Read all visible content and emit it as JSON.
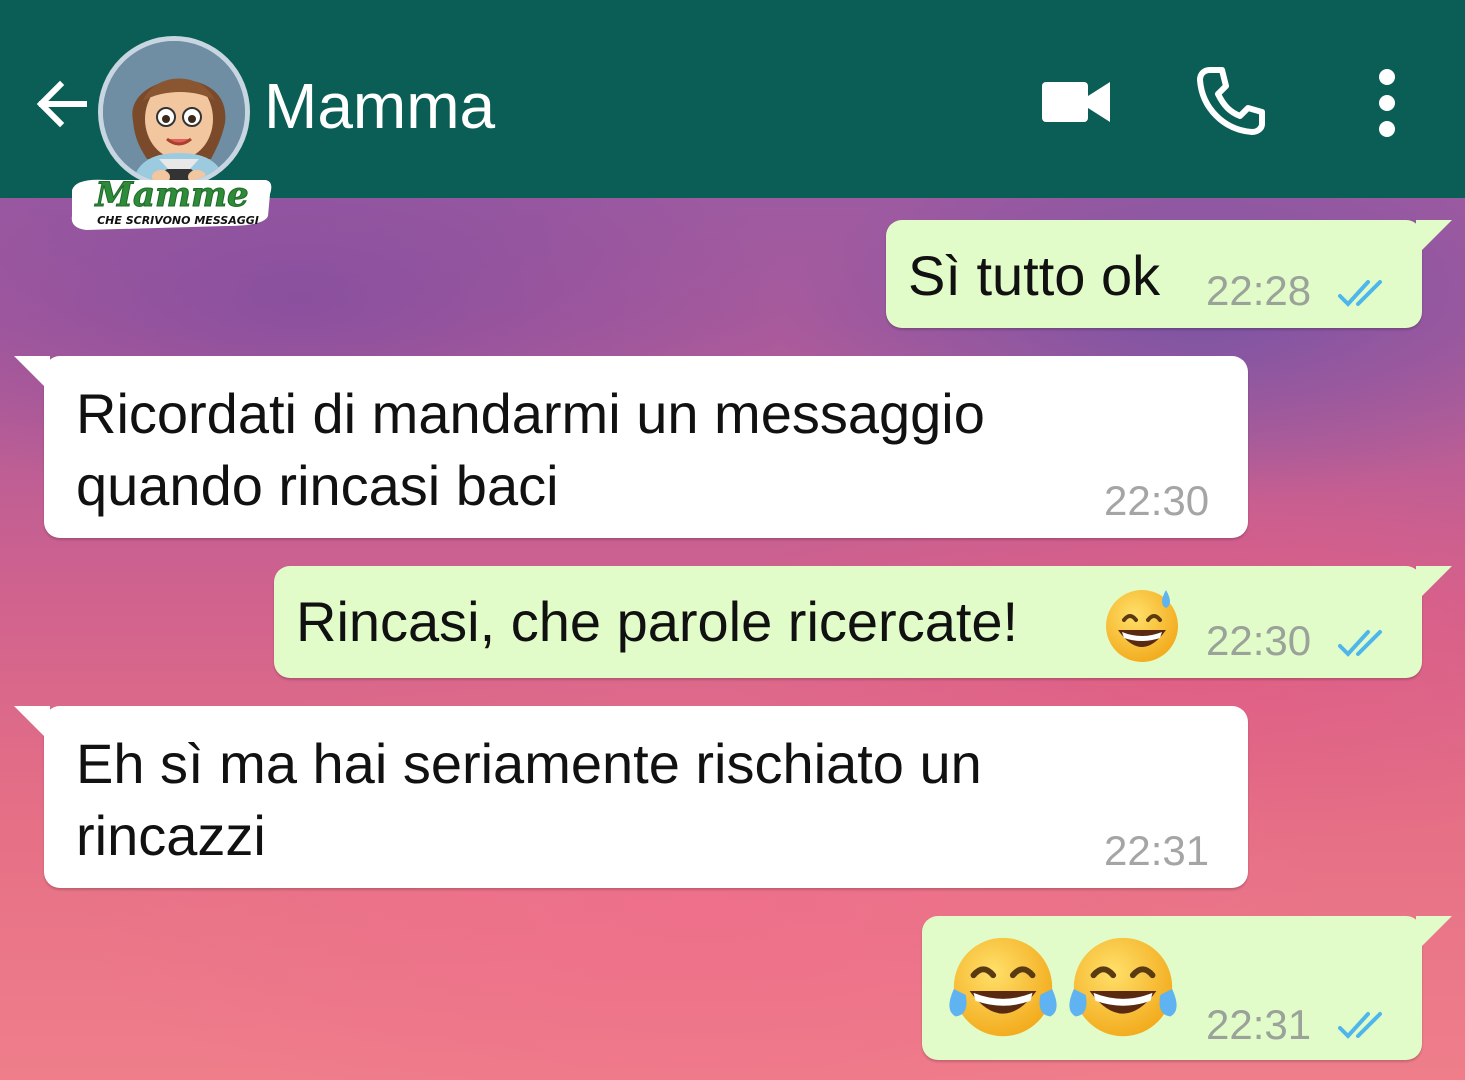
{
  "header": {
    "contact_name": "Mamma",
    "back_icon": "arrow-left-icon",
    "video_icon": "videocam-icon",
    "call_icon": "phone-icon",
    "menu_icon": "more-vert-icon",
    "background_color": "#0b5e56",
    "logo": {
      "title": "Mamme",
      "subtitle": "CHE SCRIVONO MESSAGGI"
    }
  },
  "messages": [
    {
      "direction": "out",
      "text": "Sì tutto ok",
      "time": "22:28",
      "status": "read"
    },
    {
      "direction": "in",
      "line1": "Ricordati di mandarmi un messaggio",
      "line2": "quando rincasi baci",
      "time": "22:30"
    },
    {
      "direction": "out",
      "text": "Rincasi, che parole ricercate!",
      "emoji": "grinning-sweat",
      "time": "22:30",
      "status": "read"
    },
    {
      "direction": "in",
      "line1": "Eh sì ma hai seriamente rischiato un",
      "line2": "rincazzi",
      "time": "22:31"
    },
    {
      "direction": "out",
      "emoji": [
        "tears-of-joy",
        "tears-of-joy"
      ],
      "time": "22:31",
      "status": "read"
    }
  ],
  "colors": {
    "outgoing_bubble": "#e2fcc9",
    "incoming_bubble": "#ffffff",
    "read_ticks": "#4fb6ec"
  }
}
